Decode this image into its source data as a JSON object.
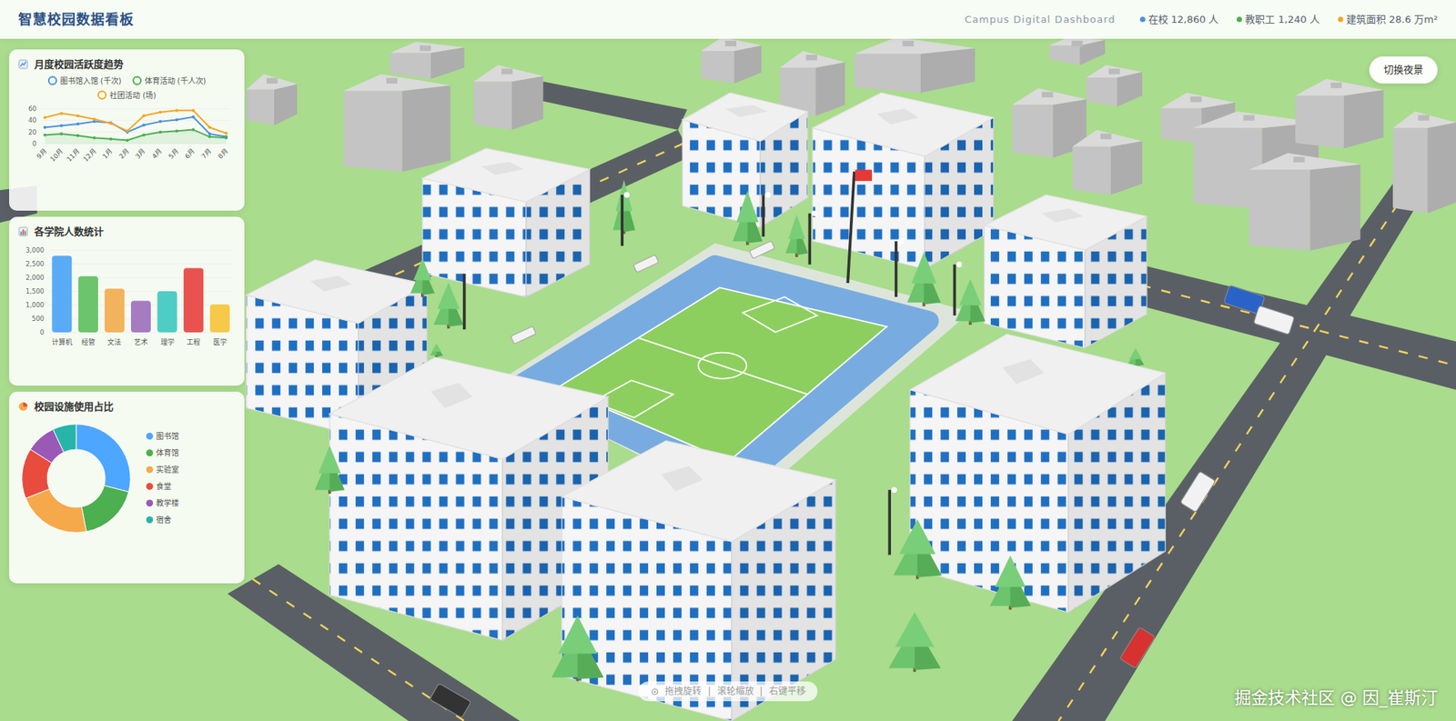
{
  "header": {
    "title": "智慧校园数据看板",
    "subtitle": "Campus Digital Dashboard",
    "stats": [
      {
        "text": "在校 12,860 人",
        "color": "#4a90e2"
      },
      {
        "text": "教职工 1,240 人",
        "color": "#4caf50"
      },
      {
        "text": "建筑面积 28.6 万m²",
        "color": "#f5a623"
      }
    ]
  },
  "night_button": "切换夜景",
  "panels": {
    "trend": {
      "title": "月度校园活跃度趋势",
      "y_ticks": [
        "60",
        "40",
        "20",
        "0"
      ],
      "months": [
        "9月",
        "10月",
        "11月",
        "12月",
        "1月",
        "2月",
        "3月",
        "4月",
        "5月",
        "6月",
        "7月",
        "8月"
      ],
      "series": [
        {
          "label": "图书馆入馆 (千次)",
          "color": "#4a90e2",
          "values": [
            28,
            31,
            34,
            38,
            36,
            20,
            32,
            38,
            41,
            46,
            17,
            12
          ]
        },
        {
          "label": "体育活动 (千人次)",
          "color": "#4caf50",
          "values": [
            15,
            17,
            14,
            10,
            8,
            6,
            15,
            20,
            22,
            24,
            12,
            10
          ]
        },
        {
          "label": "社团活动 (场)",
          "color": "#f5a623",
          "values": [
            45,
            52,
            48,
            42,
            35,
            22,
            48,
            54,
            57,
            57,
            28,
            18
          ]
        }
      ]
    },
    "colleges": {
      "title": "各学院人数统计",
      "y_ticks": [
        "3,000",
        "2,500",
        "2,000",
        "1,500",
        "1,000",
        "500",
        "0"
      ],
      "bars": [
        {
          "label": "计算机",
          "value": 2800,
          "color": "#5aabf5"
        },
        {
          "label": "经管",
          "value": 2050,
          "color": "#6cc46c"
        },
        {
          "label": "文法",
          "value": 1600,
          "color": "#f2b35c"
        },
        {
          "label": "艺术",
          "value": 1150,
          "color": "#a57cc1"
        },
        {
          "label": "理学",
          "value": 1500,
          "color": "#4ecdc4"
        },
        {
          "label": "工程",
          "value": 2350,
          "color": "#e9534f"
        },
        {
          "label": "医学",
          "value": 1020,
          "color": "#f7c948"
        }
      ]
    },
    "facilities": {
      "title": "校园设施使用占比",
      "slices": [
        {
          "label": "图书馆",
          "value": 29,
          "color": "#4da6ff"
        },
        {
          "label": "体育馆",
          "value": 18,
          "color": "#4caf50"
        },
        {
          "label": "实验室",
          "value": 22,
          "color": "#f5a94a"
        },
        {
          "label": "食堂",
          "value": 15,
          "color": "#e74c3c"
        },
        {
          "label": "教学楼",
          "value": 9,
          "color": "#9b59b6"
        },
        {
          "label": "宿舍",
          "value": 7,
          "color": "#26b5a8"
        }
      ]
    }
  },
  "hint": {
    "parts": [
      "拖拽旋转",
      "滚轮缩放",
      "右键平移"
    ],
    "separator": "|"
  },
  "watermark": "掘金技术社区 @ 因_崔斯汀"
}
